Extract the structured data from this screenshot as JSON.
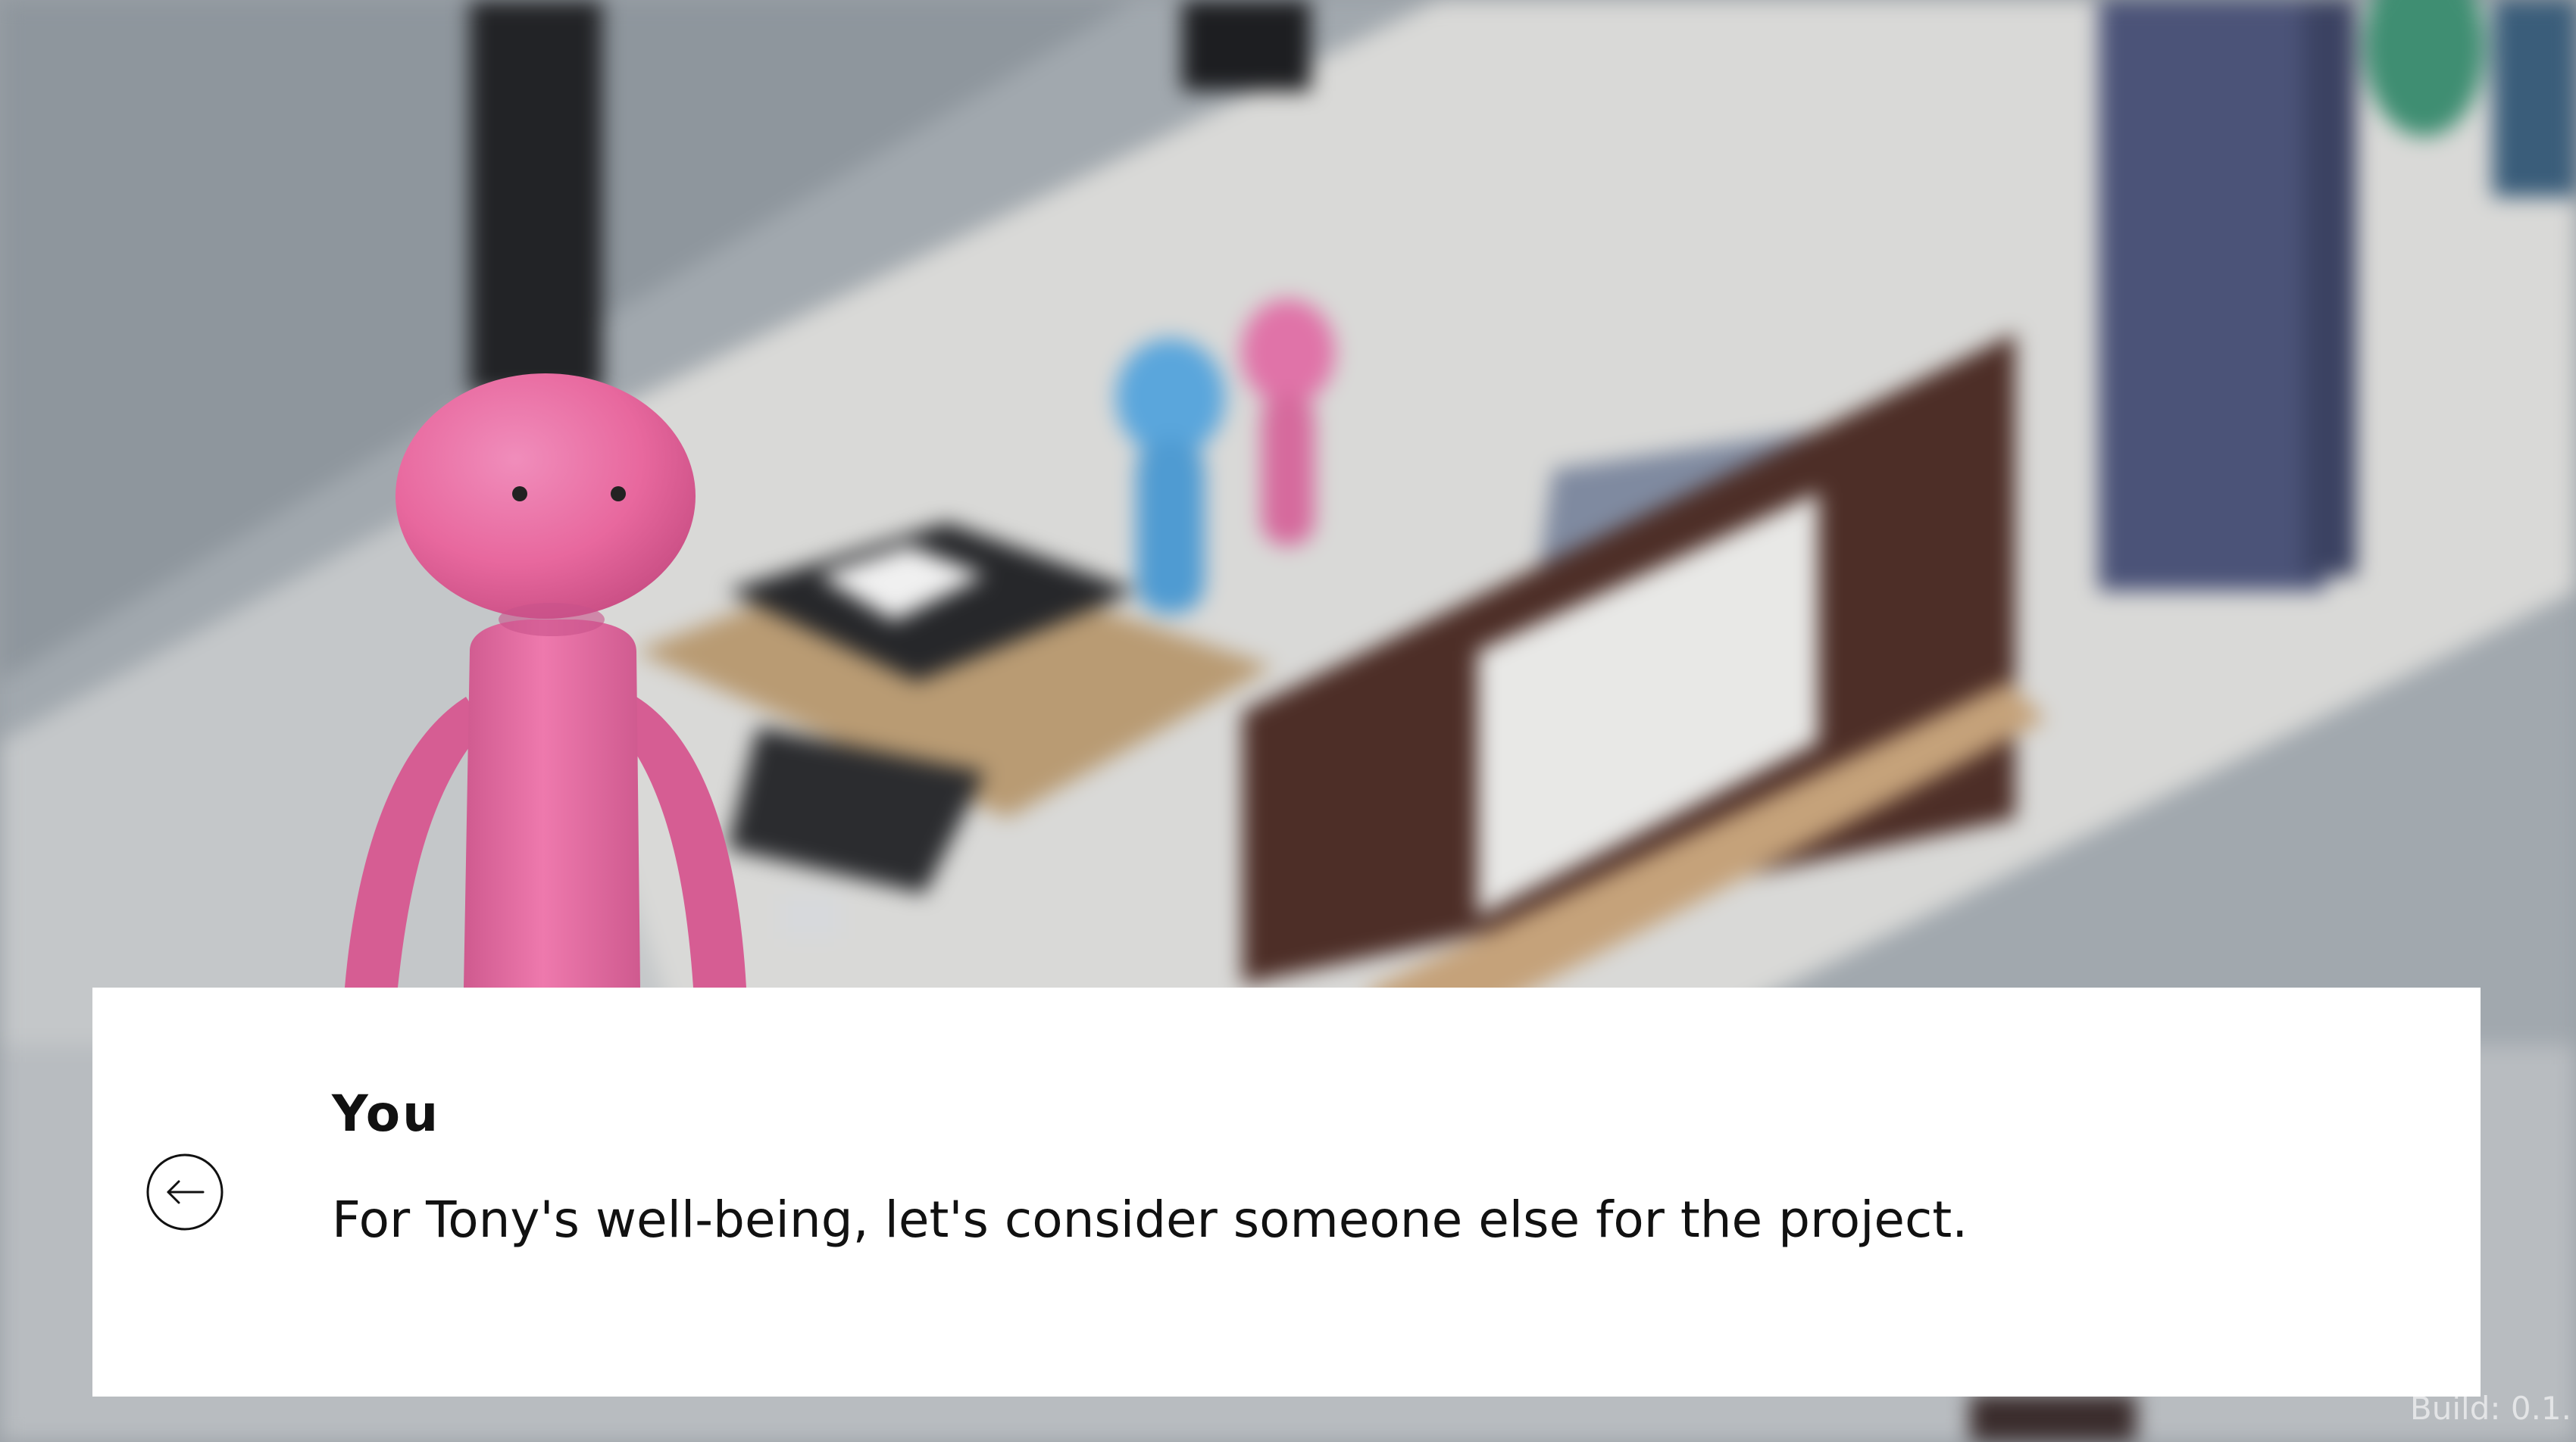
{
  "dialog": {
    "speaker": "You",
    "line": "For Tony's well-being, let's consider someone else for the project."
  },
  "back_button": {
    "icon": "arrow-left-icon"
  },
  "build_label": "Build: 0.1.",
  "colors": {
    "player_pink": "#e8689e",
    "npc_blue": "#5aa6dc",
    "npc_pink": "#e073a8",
    "dialog_bg": "#ffffff",
    "dialog_text": "#111111"
  }
}
